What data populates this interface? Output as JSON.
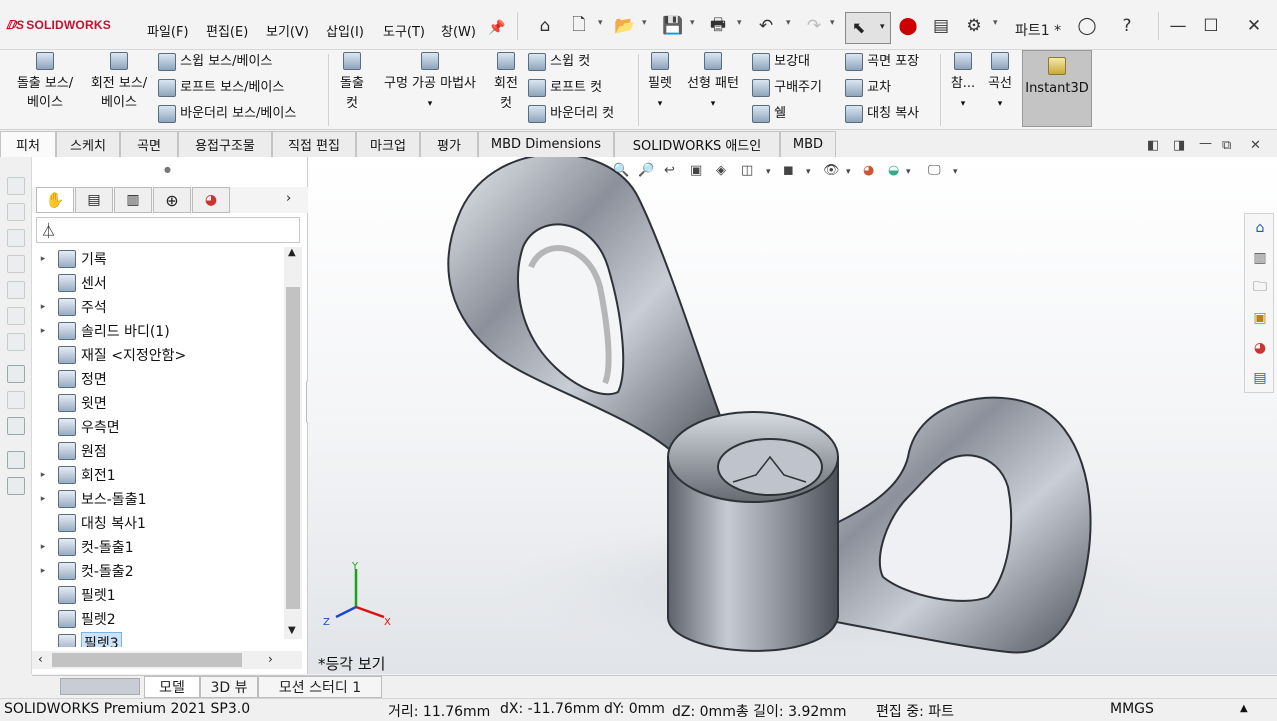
{
  "app": {
    "brand": "SOLIDWORKS",
    "doc_title": "파트1 *"
  },
  "menus": [
    "파일(F)",
    "편집(E)",
    "보기(V)",
    "삽입(I)",
    "도구(T)",
    "창(W)"
  ],
  "toolbar": {
    "icons": [
      "home-icon",
      "new-icon",
      "open-icon",
      "save-icon",
      "print-icon",
      "undo-icon",
      "redo-icon",
      "select-icon",
      "traffic-light-icon",
      "file-props-icon",
      "options-icon"
    ]
  },
  "ribbon": {
    "extrude_boss": "돌출 보스/\n베이스",
    "revolve_boss": "회전 보스/\n베이스",
    "sweep_boss": "스윕 보스/베이스",
    "loft_boss": "로프트 보스/베이스",
    "boundary_boss": "바운더리 보스/베이스",
    "extrude_cut_1": "돌출",
    "extrude_cut_2": "컷",
    "hole_wizard": "구멍 가공 마법사",
    "revolve_cut_1": "회전",
    "revolve_cut_2": "컷",
    "sweep_cut": "스윕 컷",
    "loft_cut": "로프트 컷",
    "boundary_cut": "바운더리 컷",
    "fillet": "필렛",
    "linear_pattern": "선형 패턴",
    "rib": "보강대",
    "draft": "구배주기",
    "shell": "쉘",
    "wrap": "곡면 포장",
    "intersect": "교차",
    "mirror": "대칭 복사",
    "reference": "참...",
    "curves": "곡선",
    "instant3d": "Instant3D"
  },
  "tabs": [
    "피처",
    "스케치",
    "곡면",
    "용접구조물",
    "직접 편집",
    "마크업",
    "평가",
    "MBD Dimensions",
    "SOLIDWORKS 애드인",
    "MBD"
  ],
  "tree": [
    {
      "label": "기록",
      "expand": true
    },
    {
      "label": "센서",
      "expand": false
    },
    {
      "label": "주석",
      "expand": true
    },
    {
      "label": "솔리드 바디(1)",
      "expand": true
    },
    {
      "label": "재질 <지정안함>",
      "expand": false
    },
    {
      "label": "정면",
      "expand": false
    },
    {
      "label": "윗면",
      "expand": false
    },
    {
      "label": "우측면",
      "expand": false
    },
    {
      "label": "원점",
      "expand": false
    },
    {
      "label": "회전1",
      "expand": true
    },
    {
      "label": "보스-돌출1",
      "expand": true
    },
    {
      "label": "대칭 복사1",
      "expand": false
    },
    {
      "label": "컷-돌출1",
      "expand": true
    },
    {
      "label": "컷-돌출2",
      "expand": true
    },
    {
      "label": "필렛1",
      "expand": false
    },
    {
      "label": "필렛2",
      "expand": false
    },
    {
      "label": "필렛3",
      "expand": false,
      "selected": true
    }
  ],
  "viewport": {
    "view_name": "*등각 보기",
    "triad": {
      "x": "X",
      "y": "Y",
      "z": "Z"
    }
  },
  "bottom_tabs": [
    "모델",
    "3D 뷰",
    "모션 스터디 1"
  ],
  "status": {
    "product": "SOLIDWORKS Premium 2021 SP3.0",
    "distance": "거리: 11.76mm",
    "dx": "dX: -11.76mm",
    "dy": "dY: 0mm",
    "dz": "dZ: 0mm총 길이: 3.92mm",
    "mode": "편집 중: 파트",
    "units": "MMGS"
  },
  "colors": {
    "brand_red": "#c8102e",
    "selection": "#cde3f7",
    "viewport_bg_bottom": "#e1e4e8"
  }
}
